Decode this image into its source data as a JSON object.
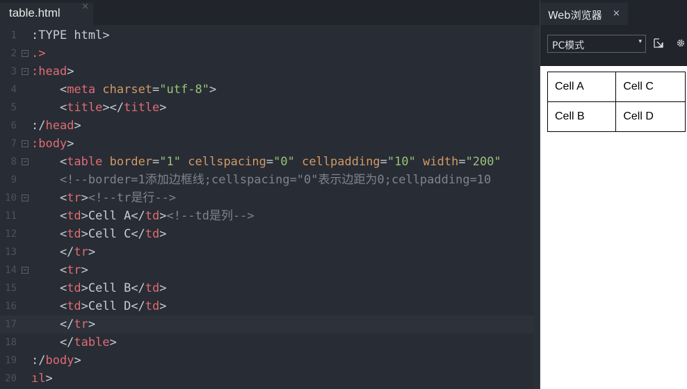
{
  "editor": {
    "tab_label": "table.html",
    "tab_close": "×",
    "lines": [
      {
        "no": "1",
        "fold": "",
        "segs": [
          {
            "c": "t-plain",
            "t": ":TYPE html>"
          }
        ]
      },
      {
        "no": "2",
        "fold": "−",
        "segs": [
          {
            "c": "t-tag",
            "t": ".>"
          }
        ]
      },
      {
        "no": "3",
        "fold": "−",
        "segs": [
          {
            "c": "t-tag",
            "t": ":head"
          },
          {
            "c": "t-plain",
            "t": ">"
          }
        ]
      },
      {
        "no": "4",
        "fold": "",
        "segs": [
          {
            "c": "t-plain",
            "t": "    <"
          },
          {
            "c": "t-tag",
            "t": "meta"
          },
          {
            "c": "t-plain",
            "t": " "
          },
          {
            "c": "t-attr",
            "t": "charset"
          },
          {
            "c": "t-plain",
            "t": "="
          },
          {
            "c": "t-str",
            "t": "\"utf-8\""
          },
          {
            "c": "t-plain",
            "t": ">"
          }
        ]
      },
      {
        "no": "5",
        "fold": "",
        "segs": [
          {
            "c": "t-plain",
            "t": "    <"
          },
          {
            "c": "t-tag",
            "t": "title"
          },
          {
            "c": "t-plain",
            "t": "></"
          },
          {
            "c": "t-tag",
            "t": "title"
          },
          {
            "c": "t-plain",
            "t": ">"
          }
        ]
      },
      {
        "no": "6",
        "fold": "",
        "segs": [
          {
            "c": "t-plain",
            "t": ":/"
          },
          {
            "c": "t-tag",
            "t": "head"
          },
          {
            "c": "t-plain",
            "t": ">"
          }
        ]
      },
      {
        "no": "7",
        "fold": "−",
        "segs": [
          {
            "c": "t-tag",
            "t": ":body"
          },
          {
            "c": "t-plain",
            "t": ">"
          }
        ]
      },
      {
        "no": "8",
        "fold": "−",
        "segs": [
          {
            "c": "t-plain",
            "t": "    <"
          },
          {
            "c": "t-tag",
            "t": "table"
          },
          {
            "c": "t-plain",
            "t": " "
          },
          {
            "c": "t-attr",
            "t": "border"
          },
          {
            "c": "t-plain",
            "t": "="
          },
          {
            "c": "t-str",
            "t": "\"1\""
          },
          {
            "c": "t-plain",
            "t": " "
          },
          {
            "c": "t-attr",
            "t": "cellspacing"
          },
          {
            "c": "t-plain",
            "t": "="
          },
          {
            "c": "t-str",
            "t": "\"0\""
          },
          {
            "c": "t-plain",
            "t": " "
          },
          {
            "c": "t-attr",
            "t": "cellpadding"
          },
          {
            "c": "t-plain",
            "t": "="
          },
          {
            "c": "t-str",
            "t": "\"10\""
          },
          {
            "c": "t-plain",
            "t": " "
          },
          {
            "c": "t-attr",
            "t": "width"
          },
          {
            "c": "t-plain",
            "t": "="
          },
          {
            "c": "t-str",
            "t": "\"200\""
          }
        ]
      },
      {
        "no": "9",
        "fold": "",
        "segs": [
          {
            "c": "t-cmt",
            "t": "    <!--border=1添加边框线;cellspacing=\"0\"表示边距为0;cellpadding=10"
          }
        ]
      },
      {
        "no": "10",
        "fold": "−",
        "segs": [
          {
            "c": "t-plain",
            "t": "    <"
          },
          {
            "c": "t-tag",
            "t": "tr"
          },
          {
            "c": "t-plain",
            "t": ">"
          },
          {
            "c": "t-cmt",
            "t": "<!--tr是行-->"
          }
        ]
      },
      {
        "no": "11",
        "fold": "",
        "segs": [
          {
            "c": "t-plain",
            "t": "    <"
          },
          {
            "c": "t-tag",
            "t": "td"
          },
          {
            "c": "t-plain",
            "t": ">Cell A</"
          },
          {
            "c": "t-tag",
            "t": "td"
          },
          {
            "c": "t-plain",
            "t": ">"
          },
          {
            "c": "t-cmt",
            "t": "<!--td是列-->"
          }
        ]
      },
      {
        "no": "12",
        "fold": "",
        "segs": [
          {
            "c": "t-plain",
            "t": "    <"
          },
          {
            "c": "t-tag",
            "t": "td"
          },
          {
            "c": "t-plain",
            "t": ">Cell C</"
          },
          {
            "c": "t-tag",
            "t": "td"
          },
          {
            "c": "t-plain",
            "t": ">"
          }
        ]
      },
      {
        "no": "13",
        "fold": "",
        "segs": [
          {
            "c": "t-plain",
            "t": "    </"
          },
          {
            "c": "t-tag",
            "t": "tr"
          },
          {
            "c": "t-plain",
            "t": ">"
          }
        ]
      },
      {
        "no": "14",
        "fold": "−",
        "segs": [
          {
            "c": "t-plain",
            "t": "    <"
          },
          {
            "c": "t-tag",
            "t": "tr"
          },
          {
            "c": "t-plain",
            "t": ">"
          }
        ]
      },
      {
        "no": "15",
        "fold": "",
        "segs": [
          {
            "c": "t-plain",
            "t": "    <"
          },
          {
            "c": "t-tag",
            "t": "td"
          },
          {
            "c": "t-plain",
            "t": ">Cell B</"
          },
          {
            "c": "t-tag",
            "t": "td"
          },
          {
            "c": "t-plain",
            "t": ">"
          }
        ]
      },
      {
        "no": "16",
        "fold": "",
        "segs": [
          {
            "c": "t-plain",
            "t": "    <"
          },
          {
            "c": "t-tag",
            "t": "td"
          },
          {
            "c": "t-plain",
            "t": ">Cell D</"
          },
          {
            "c": "t-tag",
            "t": "td"
          },
          {
            "c": "t-plain",
            "t": ">"
          }
        ]
      },
      {
        "no": "17",
        "fold": "",
        "active": true,
        "segs": [
          {
            "c": "t-plain",
            "t": "    </"
          },
          {
            "c": "t-tag",
            "t": "tr"
          },
          {
            "c": "t-plain",
            "t": ">"
          }
        ]
      },
      {
        "no": "18",
        "fold": "",
        "segs": [
          {
            "c": "t-plain",
            "t": "    </"
          },
          {
            "c": "t-tag",
            "t": "table"
          },
          {
            "c": "t-plain",
            "t": ">"
          }
        ]
      },
      {
        "no": "19",
        "fold": "",
        "segs": [
          {
            "c": "t-plain",
            "t": ":/"
          },
          {
            "c": "t-tag",
            "t": "body"
          },
          {
            "c": "t-plain",
            "t": ">"
          }
        ]
      },
      {
        "no": "20",
        "fold": "",
        "segs": [
          {
            "c": "t-tag",
            "t": "ıl"
          },
          {
            "c": "t-plain",
            "t": ">"
          }
        ]
      }
    ]
  },
  "browser": {
    "tab_label": "Web浏览器",
    "tab_close": "×",
    "mode_select": {
      "value": "PC模式",
      "caret": "▾"
    },
    "popout_icon": "popout-icon",
    "settings_icon": "gear-icon",
    "preview_table": {
      "rows": [
        [
          "Cell A",
          "Cell C"
        ],
        [
          "Cell B",
          "Cell D"
        ]
      ]
    }
  },
  "colors": {
    "editor_bg": "#282c34",
    "tag": "#e06c75",
    "attr": "#d19a66",
    "string": "#98c379",
    "comment": "#7f848e",
    "text": "#c8ccd4",
    "line_number": "#4b5263"
  }
}
